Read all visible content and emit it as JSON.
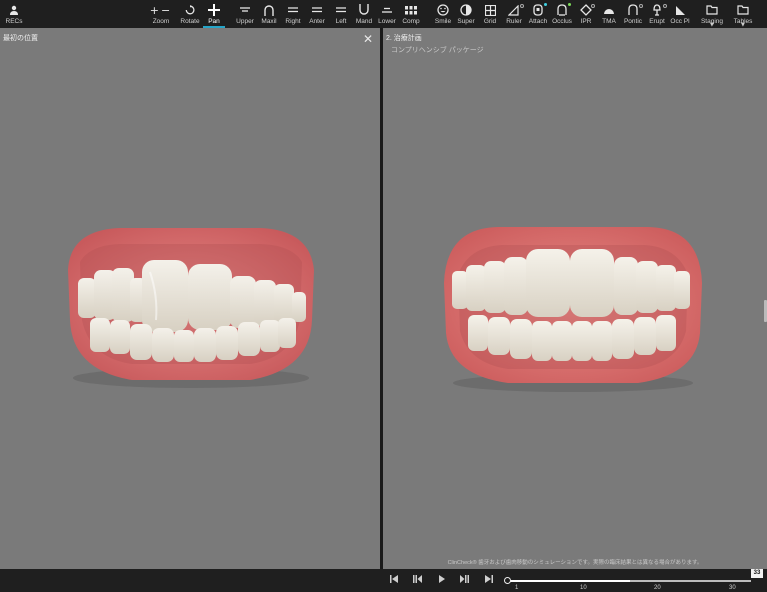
{
  "toolbar": {
    "recs": "RECs",
    "zoom": "Zoom",
    "rotate": "Rotate",
    "pan": "Pan",
    "upper": "Upper",
    "maxil": "Maxil",
    "right": "Right",
    "anter": "Anter",
    "left": "Left",
    "mand": "Mand",
    "lower": "Lower",
    "comp": "Comp",
    "smile": "Smile",
    "super": "Super",
    "grid": "Grid",
    "ruler": "Ruler",
    "attach": "Attach",
    "occlus": "Occlus",
    "ipr": "IPR",
    "tma": "TMA",
    "pontic": "Pontic",
    "erupt": "Erupt",
    "occpl": "Occ Pl",
    "staging": "Staging",
    "tables": "Tables",
    "accent_color": "#25a5c8",
    "attach_dot_color": "#3fd0e0",
    "occlus_dot_color": "#7ddc5a"
  },
  "left_panel": {
    "title": "最初の位置",
    "close_icon": "close-icon"
  },
  "right_panel": {
    "title": "2. 治療計画",
    "subtitle": "コンプリヘンシブ パッケージ",
    "disclaimer": "ClinCheck® 歯牙および歯肉移動のシミュレーションです。実際の臨床結果とは異なる場合があります。"
  },
  "playback": {
    "tick_1": "1",
    "tick_10": "10",
    "tick_20": "20",
    "tick_30": "30",
    "current_stage": "33",
    "progress_fraction": 0.5
  }
}
